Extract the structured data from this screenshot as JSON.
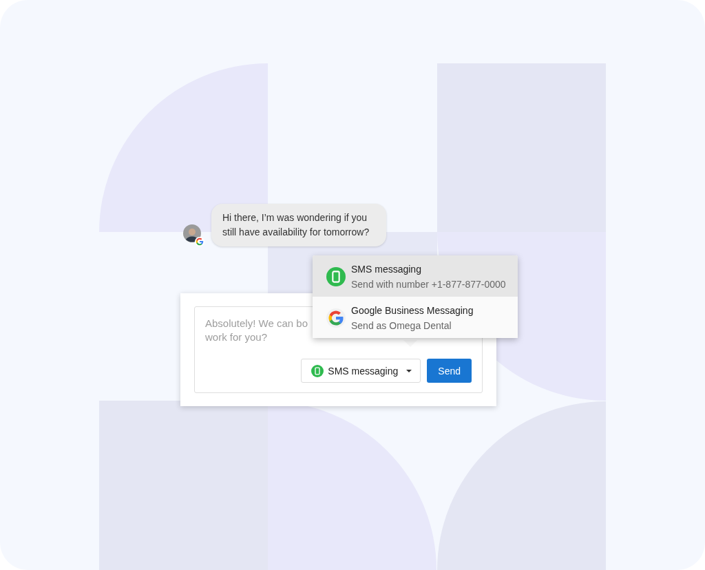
{
  "chat": {
    "message": "Hi there, I’m was wondering if you still have availability for tomorrow?"
  },
  "composer": {
    "text_lines": [
      "Absolutely! We can bo",
      "work for you?"
    ],
    "channel_dropdown": {
      "label": "SMS messaging",
      "kind": "sms"
    },
    "send_button": "Send"
  },
  "channel_menu": {
    "items": [
      {
        "kind": "sms",
        "title": "SMS messaging",
        "subtitle": "Send with number +1-877-877-0000",
        "selected": true
      },
      {
        "kind": "google",
        "title": "Google Business Messaging",
        "subtitle": "Send as Omega Dental",
        "selected": false
      }
    ]
  }
}
